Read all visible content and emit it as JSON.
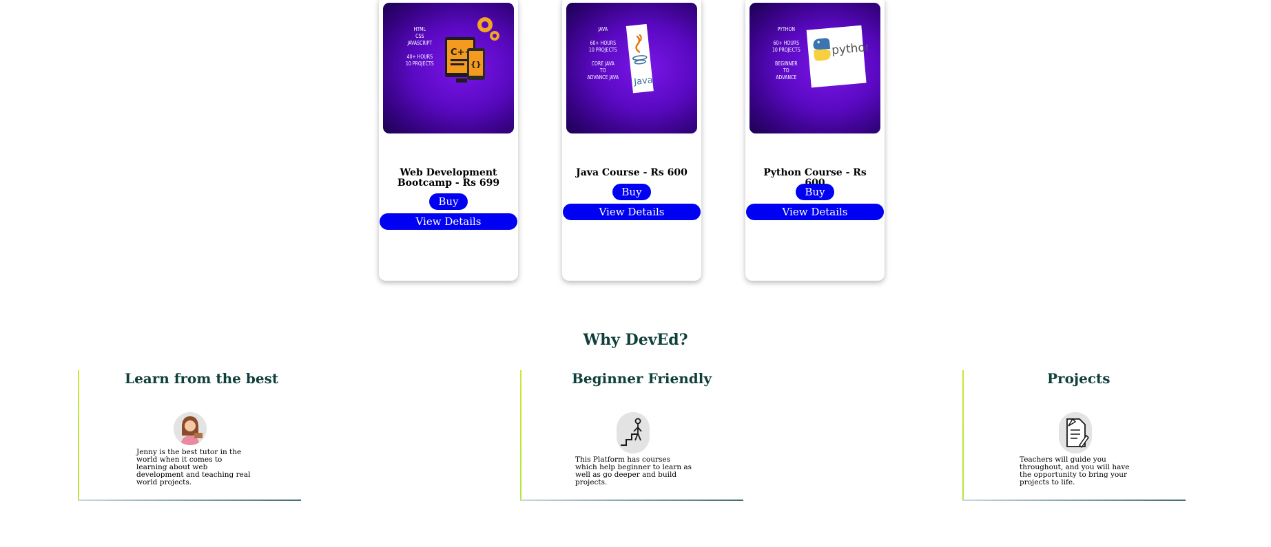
{
  "courses": [
    {
      "thumb_text": "HTML\nCSS\nJAVASCRIPT\n\n40+ HOURS\n10 PROJECTS",
      "icon": "code-device-icon",
      "title": "Web Development Bootcamp - Rs 699",
      "buy_label": "Buy",
      "details_label": "View Details"
    },
    {
      "thumb_text": "JAVA\n\n60+ HOURS\n10 PROJECTS\n\nCORE JAVA\nTO\nADVANCE JAVA",
      "icon": "java-logo-icon",
      "logo_text": "Java",
      "title": "Java Course - Rs 600",
      "buy_label": "Buy",
      "details_label": "View Details"
    },
    {
      "thumb_text": "PYTHON\n\n60+ HOURS\n10 PROJECTS\n\nBEGINNER\nTO\nADVANCE",
      "icon": "python-logo-icon",
      "logo_text": "python",
      "title": "Python Course - Rs 600",
      "buy_label": "Buy",
      "details_label": "View Details"
    }
  ],
  "why": {
    "heading": "Why DevEd?",
    "features": [
      {
        "title": "Learn from the best",
        "icon": "tutor-avatar-icon",
        "desc": "Jenny is the best tutor in the world when it comes to learning about web development and teaching real world projects."
      },
      {
        "title": "Beginner Friendly",
        "icon": "climbing-stairs-icon",
        "desc": "This Platform has courses which help beginner to learn as well as go deeper and build projects."
      },
      {
        "title": "Projects",
        "icon": "project-document-icon",
        "desc": "Teachers will guide you throughout, and you will have the opportunity to bring your projects to life."
      }
    ]
  },
  "colors": {
    "button": "#0000f2",
    "heading": "#0f3f3a",
    "accent_bar": "#c6ea2c"
  }
}
